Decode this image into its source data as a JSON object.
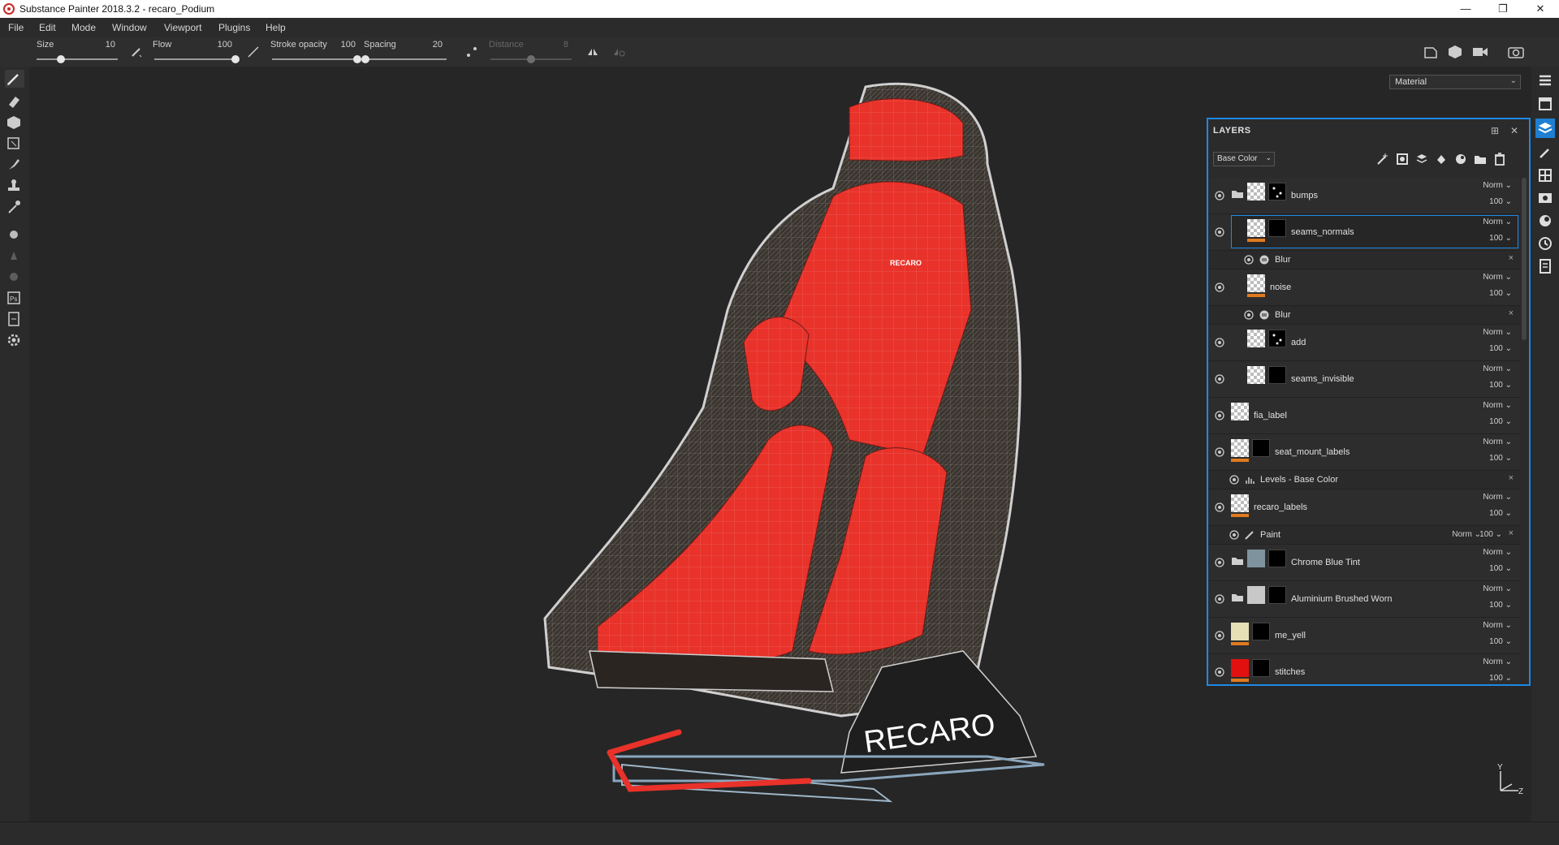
{
  "window": {
    "title": "Substance Painter 2018.3.2 - recaro_Podium"
  },
  "menu": [
    "File",
    "Edit",
    "Mode",
    "Window",
    "Viewport",
    "Plugins",
    "Help"
  ],
  "tool_options": {
    "size": {
      "label": "Size",
      "value": "10",
      "fraction": 0.3
    },
    "flow": {
      "label": "Flow",
      "value": "100",
      "fraction": 1.0
    },
    "stroke_opacity": {
      "label": "Stroke opacity",
      "value": "100",
      "fraction": 1.0
    },
    "spacing": {
      "label": "Spacing",
      "value": "20",
      "fraction": 0.0
    },
    "distance": {
      "label": "Distance",
      "value": "8",
      "fraction": 0.5
    }
  },
  "viewport": {
    "material_select": "Material",
    "model_logo_text": "RECARO",
    "headrest_logo": "RECARO"
  },
  "layers_panel": {
    "title": "LAYERS",
    "channel": "Base Color",
    "rows": [
      {
        "kind": "layer",
        "name": "bumps",
        "blend": "Norm",
        "opacity": "100",
        "folder": true,
        "thumb": "checker",
        "mask": "spots"
      },
      {
        "kind": "layer",
        "name": "seams_normals",
        "blend": "Norm",
        "opacity": "100",
        "selected": true,
        "thumb": "checker",
        "mask": "black",
        "bar": "#e07a1f"
      },
      {
        "kind": "effect",
        "name": "Blur"
      },
      {
        "kind": "layer",
        "name": "noise",
        "blend": "Norm",
        "opacity": "100",
        "thumb": "checker",
        "bar": "#e07a1f"
      },
      {
        "kind": "effect",
        "name": "Blur"
      },
      {
        "kind": "layer",
        "name": "add",
        "blend": "Norm",
        "opacity": "100",
        "thumb": "checker",
        "mask": "spots"
      },
      {
        "kind": "layer",
        "name": "seams_invisible",
        "blend": "Norm",
        "opacity": "100",
        "thumb": "checker",
        "mask": "black"
      },
      {
        "kind": "layer",
        "name": "fia_label",
        "blend": "Norm",
        "opacity": "100",
        "thumb": "checker"
      },
      {
        "kind": "layer",
        "name": "seat_mount_labels",
        "blend": "Norm",
        "opacity": "100",
        "thumb": "checker",
        "mask": "black",
        "bar": "#e07a1f"
      },
      {
        "kind": "effect",
        "name": "Levels - Base Color"
      },
      {
        "kind": "layer",
        "name": "recaro_labels",
        "blend": "Norm",
        "opacity": "100",
        "thumb": "checker",
        "bar": "#e07a1f"
      },
      {
        "kind": "effect",
        "name": "Paint",
        "blend": "Norm",
        "opacity": "100"
      },
      {
        "kind": "layer",
        "name": "Chrome Blue Tint",
        "blend": "Norm",
        "opacity": "100",
        "folder": true,
        "thumb": "chrome",
        "mask": "black"
      },
      {
        "kind": "layer",
        "name": "Aluminium Brushed Worn",
        "blend": "Norm",
        "opacity": "100",
        "folder": true,
        "thumb": "alu",
        "mask": "black"
      },
      {
        "kind": "layer",
        "name": "me_yell",
        "blend": "Norm",
        "opacity": "100",
        "thumb": "yell",
        "mask": "black",
        "bar": "#e07a1f"
      },
      {
        "kind": "layer",
        "name": "stitches",
        "blend": "Norm",
        "opacity": "100",
        "thumb": "red",
        "mask": "black",
        "bar": "#e07a1f"
      }
    ]
  },
  "colors": {
    "accent": "#1e88e5",
    "seat_red": "#e8322a",
    "orange_bar": "#e07a1f"
  },
  "gizmo": {
    "y": "Y",
    "z": "Z"
  }
}
